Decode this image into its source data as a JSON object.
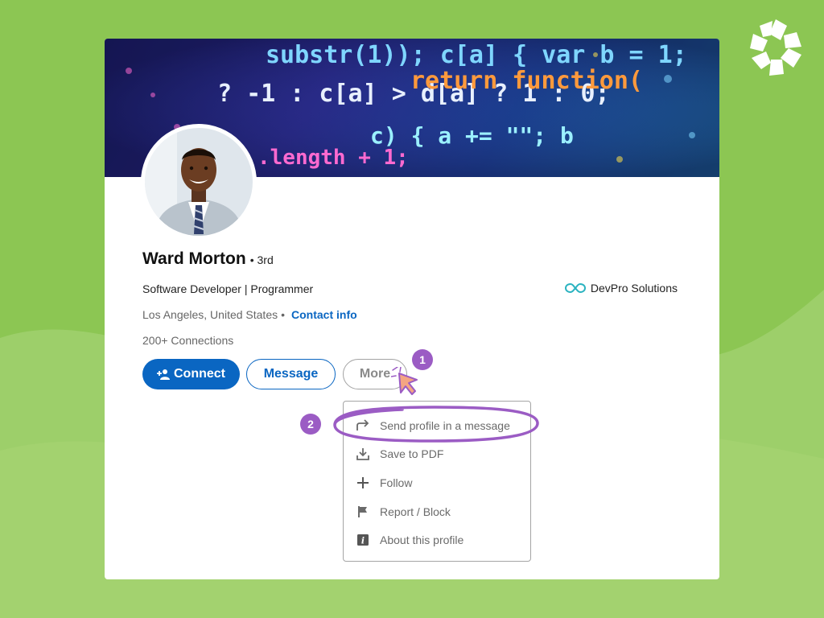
{
  "profile": {
    "name": "Ward Morton",
    "degree": "• 3rd",
    "headline": "Software Developer | Programmer",
    "company": "DevPro Solutions",
    "location": "Los Angeles, United States",
    "separator": "•",
    "contact_info": "Contact info",
    "connections": "200+ Connections"
  },
  "actions": {
    "connect": "Connect",
    "message": "Message",
    "more": "More"
  },
  "more_menu": {
    "items": [
      {
        "label": "Send profile in a message",
        "icon": "share-arrow-icon"
      },
      {
        "label": "Save to PDF",
        "icon": "download-icon"
      },
      {
        "label": "Follow",
        "icon": "plus-icon"
      },
      {
        "label": "Report / Block",
        "icon": "flag-icon"
      },
      {
        "label": "About this profile",
        "icon": "info-icon"
      }
    ]
  },
  "annotations": {
    "step1": "1",
    "step2": "2"
  },
  "cover_code": {
    "line1": "substr(1)); c[a] { var b = 1;",
    "line2": "? -1 : c[a] > d[a] ? 1 : 0;",
    "line3": "return function(",
    "line4": "c) { a += \"\"; b",
    "line5": ".length + 1;"
  },
  "colors": {
    "background": "#8cc653",
    "primary_blue": "#0a66c2",
    "annotation_purple": "#9b5cc4",
    "cursor_orange": "#f4a582"
  }
}
